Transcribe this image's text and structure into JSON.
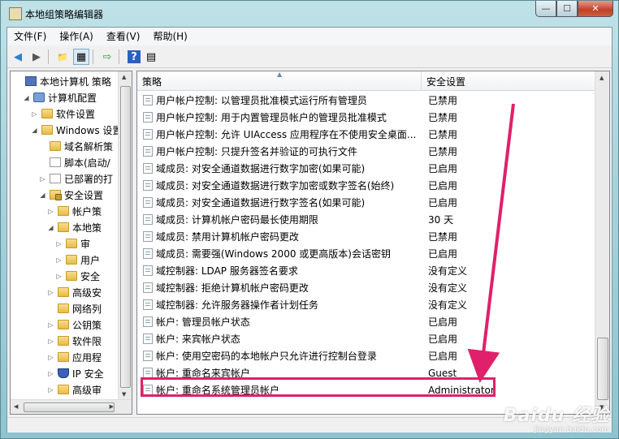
{
  "window": {
    "title": "本地组策略编辑器",
    "min_symbol": "—",
    "max_symbol": "☐",
    "close_symbol": "✕"
  },
  "menu": [
    "文件(F)",
    "操作(A)",
    "查看(V)",
    "帮助(H)"
  ],
  "toolbar": {
    "back_icon": "◀",
    "forward_icon": "▶",
    "up_icon": "📁",
    "view_icon": "▦",
    "export_icon": "⇨",
    "help_icon": "?",
    "props_icon": "▤"
  },
  "tree": [
    {
      "label": "本地计算机 策略",
      "twisty": "",
      "icon": "policy",
      "indent": 0
    },
    {
      "label": "计算机配置",
      "twisty": "◢",
      "icon": "user",
      "indent": 1
    },
    {
      "label": "软件设置",
      "twisty": "▷",
      "icon": "folder",
      "indent": 2
    },
    {
      "label": "Windows 设置",
      "twisty": "◢",
      "icon": "folder",
      "indent": 2
    },
    {
      "label": "域名解析策",
      "twisty": "",
      "icon": "folder",
      "indent": 3
    },
    {
      "label": "脚本(启动/",
      "twisty": "",
      "icon": "doc",
      "indent": 3
    },
    {
      "label": "已部署的打",
      "twisty": "▷",
      "icon": "doc",
      "indent": 3
    },
    {
      "label": "安全设置",
      "twisty": "◢",
      "icon": "sec",
      "indent": 3
    },
    {
      "label": "帐户策",
      "twisty": "▷",
      "icon": "folder",
      "indent": 4
    },
    {
      "label": "本地策",
      "twisty": "◢",
      "icon": "folder",
      "indent": 4
    },
    {
      "label": "审",
      "twisty": "▷",
      "icon": "folder",
      "indent": 5
    },
    {
      "label": "用户",
      "twisty": "▷",
      "icon": "folder",
      "indent": 5
    },
    {
      "label": "安全",
      "twisty": "▷",
      "icon": "folder",
      "indent": 5
    },
    {
      "label": "高级安",
      "twisty": "▷",
      "icon": "folder",
      "indent": 4
    },
    {
      "label": "网络列",
      "twisty": "",
      "icon": "folder",
      "indent": 4
    },
    {
      "label": "公钥策",
      "twisty": "▷",
      "icon": "folder",
      "indent": 4
    },
    {
      "label": "软件限",
      "twisty": "▷",
      "icon": "folder",
      "indent": 4
    },
    {
      "label": "应用程",
      "twisty": "▷",
      "icon": "folder",
      "indent": 4
    },
    {
      "label": "IP 安全",
      "twisty": "▷",
      "icon": "shield",
      "indent": 4
    },
    {
      "label": "高级审",
      "twisty": "▷",
      "icon": "folder",
      "indent": 4
    }
  ],
  "list": {
    "columns": [
      "策略",
      "安全设置"
    ],
    "rows": [
      {
        "policy": "用户帐户控制: 以管理员批准模式运行所有管理员",
        "setting": "已禁用"
      },
      {
        "policy": "用户帐户控制: 用于内置管理员帐户的管理员批准模式",
        "setting": "已禁用"
      },
      {
        "policy": "用户帐户控制: 允许 UIAccess 应用程序在不使用安全桌面...",
        "setting": "已禁用"
      },
      {
        "policy": "用户帐户控制: 只提升签名并验证的可执行文件",
        "setting": "已禁用"
      },
      {
        "policy": "域成员: 对安全通道数据进行数字加密(如果可能)",
        "setting": "已启用"
      },
      {
        "policy": "域成员: 对安全通道数据进行数字加密或数字签名(始终)",
        "setting": "已启用"
      },
      {
        "policy": "域成员: 对安全通道数据进行数字签名(如果可能)",
        "setting": "已启用"
      },
      {
        "policy": "域成员: 计算机帐户密码最长使用期限",
        "setting": "30 天"
      },
      {
        "policy": "域成员: 禁用计算机帐户密码更改",
        "setting": "已禁用"
      },
      {
        "policy": "域成员: 需要强(Windows 2000 或更高版本)会话密钥",
        "setting": "已启用"
      },
      {
        "policy": "域控制器: LDAP 服务器签名要求",
        "setting": "没有定义"
      },
      {
        "policy": "域控制器: 拒绝计算机帐户密码更改",
        "setting": "没有定义"
      },
      {
        "policy": "域控制器: 允许服务器操作者计划任务",
        "setting": "没有定义"
      },
      {
        "policy": "帐户: 管理员帐户状态",
        "setting": "已启用"
      },
      {
        "policy": "帐户: 来宾帐户状态",
        "setting": "已启用"
      },
      {
        "policy": "帐户: 使用空密码的本地帐户只允许进行控制台登录",
        "setting": "已启用"
      },
      {
        "policy": "帐户: 重命名来宾帐户",
        "setting": "Guest"
      },
      {
        "policy": "帐户: 重命名系统管理员帐户",
        "setting": "Administrator"
      }
    ]
  },
  "annotation": {
    "color": "#e0206a"
  },
  "watermark": {
    "logo": "Baidu 经验",
    "url": "jingyan.baidu.com"
  }
}
